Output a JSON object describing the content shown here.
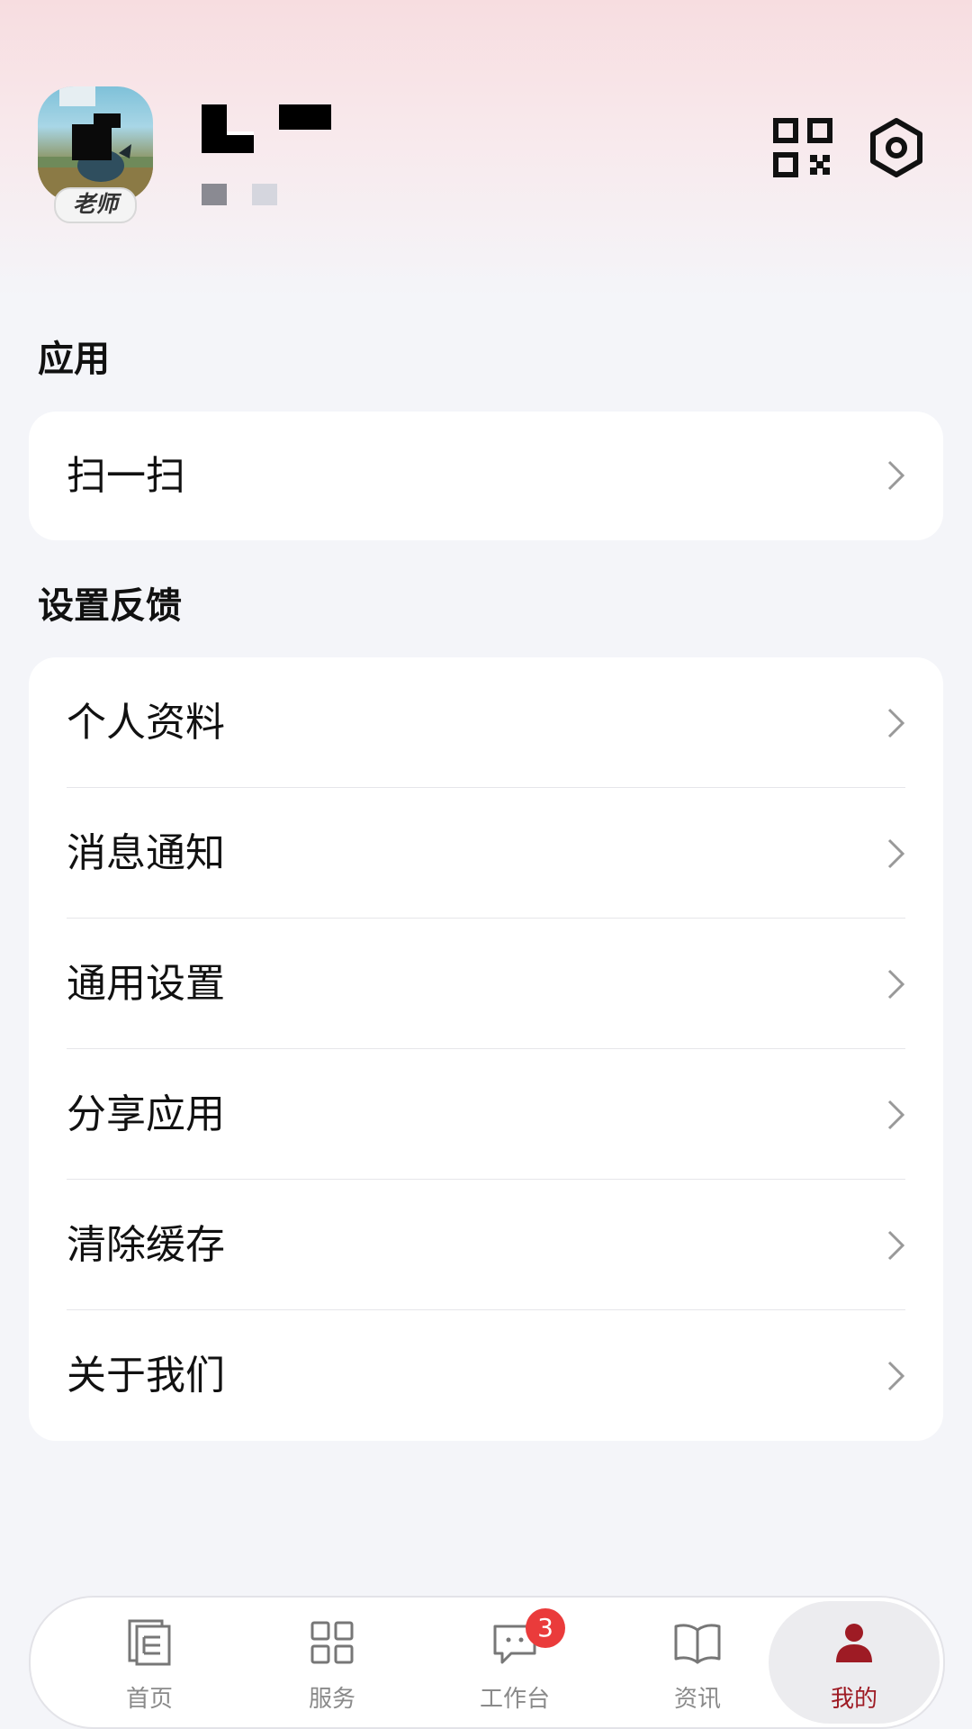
{
  "profile": {
    "badge_label": "老师"
  },
  "sections": {
    "apps": {
      "title": "应用",
      "items": [
        {
          "label": "扫一扫"
        }
      ]
    },
    "settings": {
      "title": "设置反馈",
      "items": [
        {
          "label": "个人资料"
        },
        {
          "label": "消息通知"
        },
        {
          "label": "通用设置"
        },
        {
          "label": "分享应用"
        },
        {
          "label": "清除缓存"
        },
        {
          "label": "关于我们"
        }
      ]
    }
  },
  "header_icons": [
    "qr-code-icon",
    "settings-hexagon-icon"
  ],
  "tabbar": {
    "tabs": [
      {
        "label": "首页",
        "icon": "home-document-icon"
      },
      {
        "label": "服务",
        "icon": "grid-icon"
      },
      {
        "label": "工作台",
        "icon": "chat-bubble-icon",
        "badge": "3"
      },
      {
        "label": "资讯",
        "icon": "open-book-icon"
      },
      {
        "label": "我的",
        "icon": "person-icon"
      }
    ],
    "active_index": 4
  },
  "colors": {
    "accent": "#9e1b24",
    "badge": "#ea3b3b",
    "background": "#f4f5f9",
    "header_tint": "#f7dde0"
  }
}
